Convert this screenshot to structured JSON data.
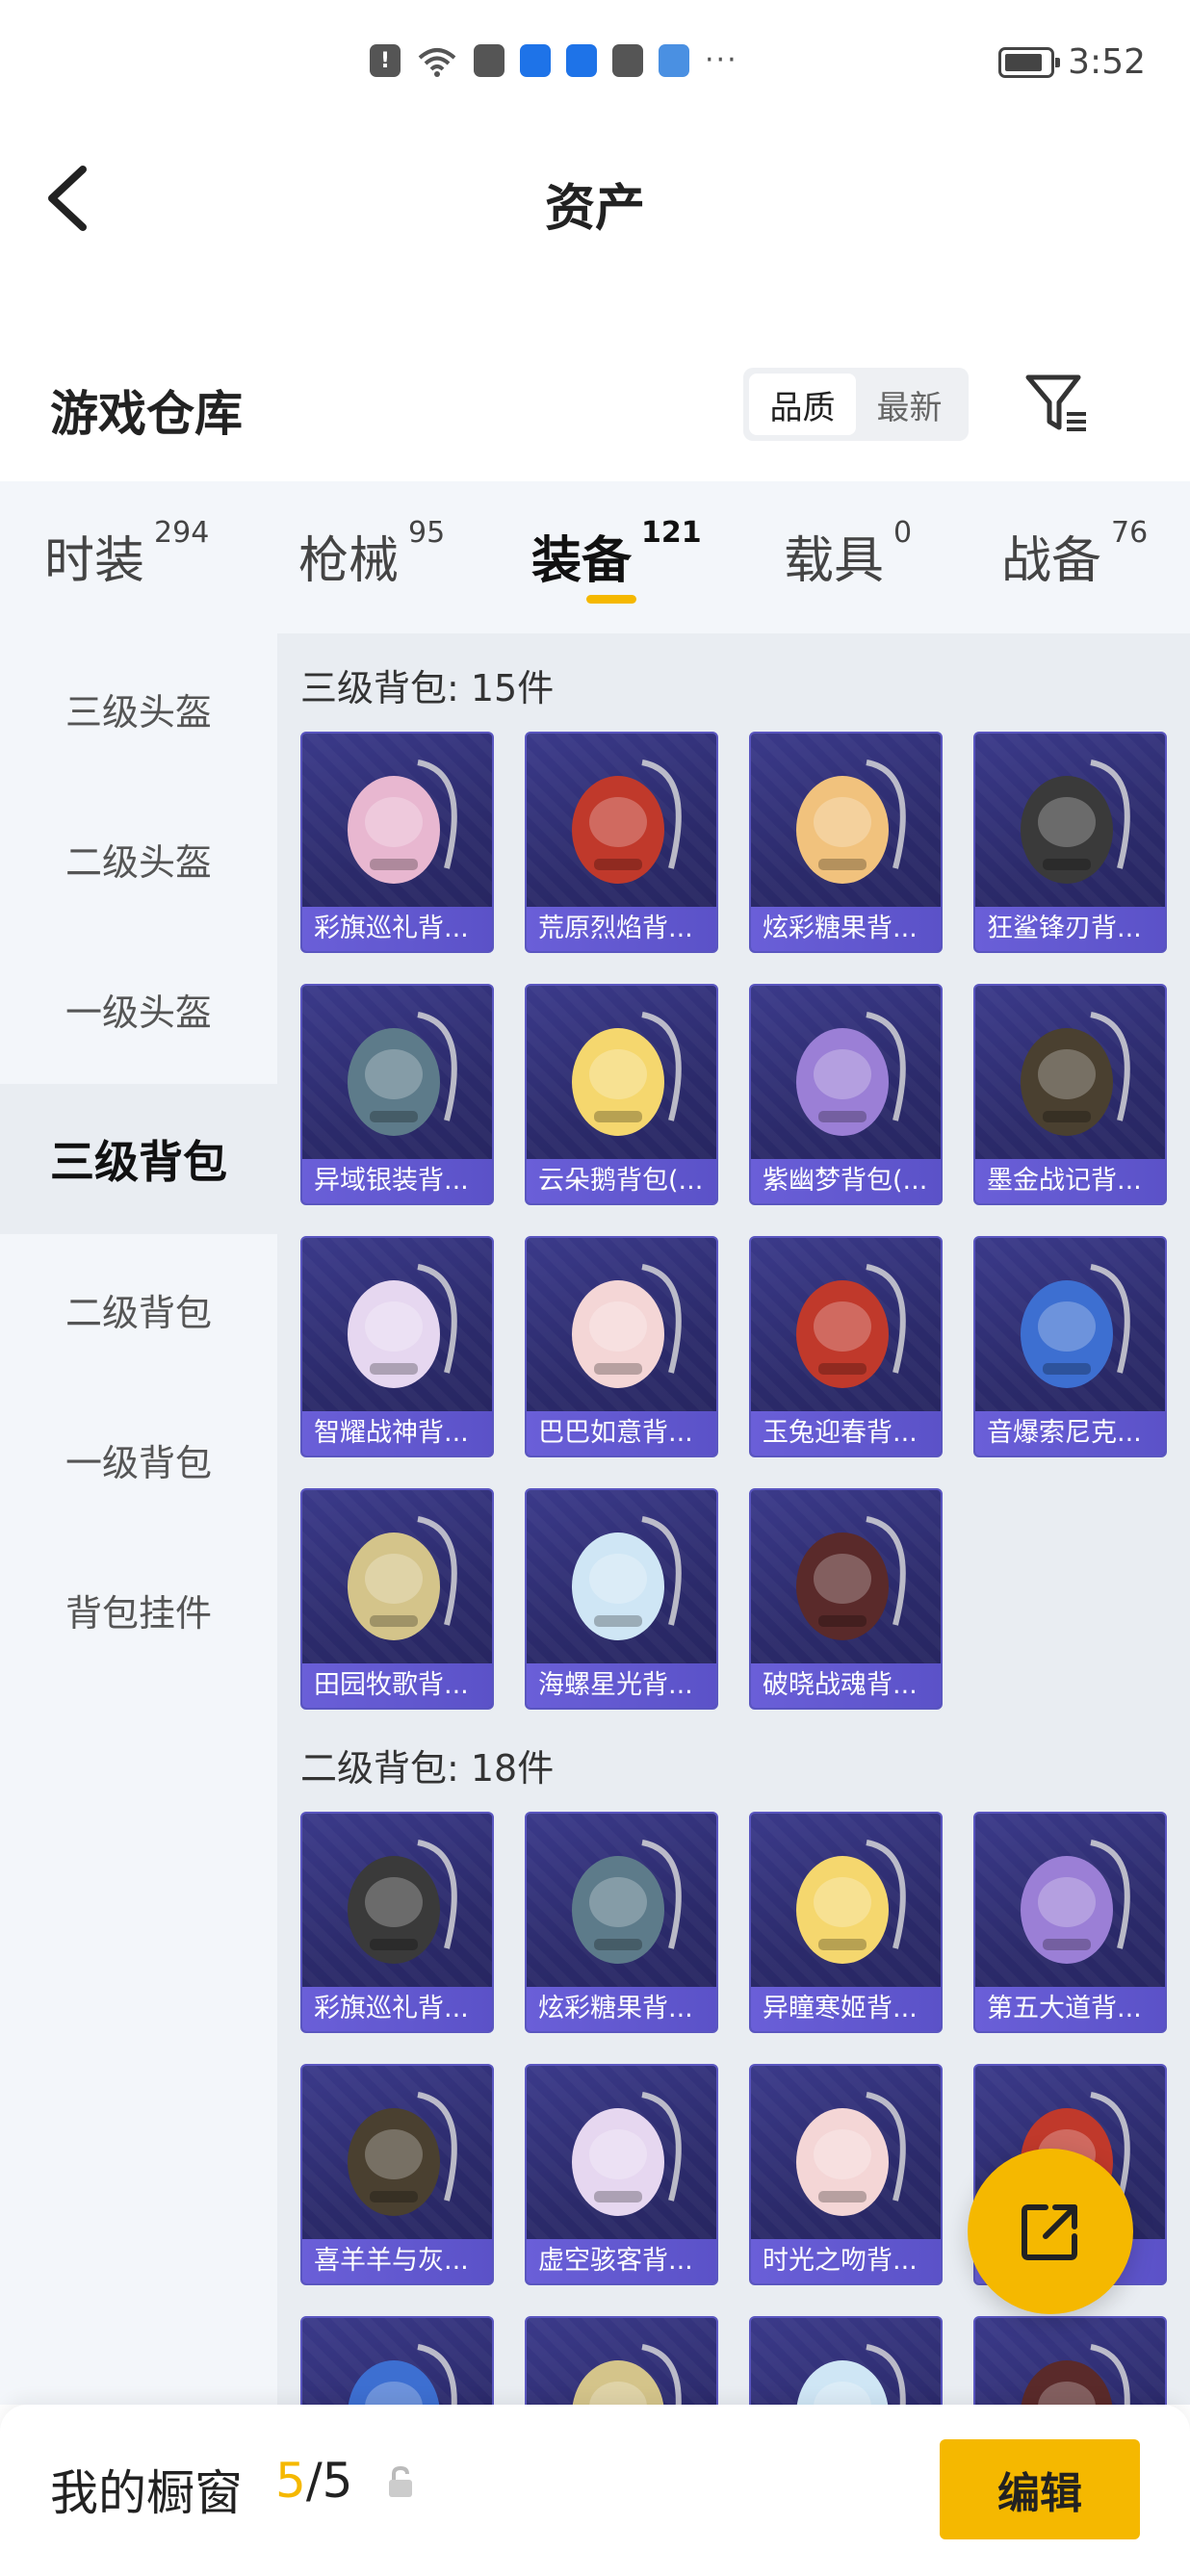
{
  "status_bar": {
    "time": "3:52",
    "signal": "6",
    "more": "···"
  },
  "nav": {
    "title": "资产"
  },
  "warehouse": {
    "title": "游戏仓库",
    "sort_options": [
      "品质",
      "最新"
    ],
    "sort_active": "品质"
  },
  "category_tabs": [
    {
      "label": "时装",
      "count": "294"
    },
    {
      "label": "枪械",
      "count": "95"
    },
    {
      "label": "装备",
      "count": "121",
      "active": true
    },
    {
      "label": "载具",
      "count": "0"
    },
    {
      "label": "战备",
      "count": "76"
    }
  ],
  "side_menu": [
    {
      "label": "三级头盔"
    },
    {
      "label": "二级头盔"
    },
    {
      "label": "一级头盔"
    },
    {
      "label": "三级背包",
      "active": true
    },
    {
      "label": "二级背包"
    },
    {
      "label": "一级背包"
    },
    {
      "label": "背包挂件"
    }
  ],
  "sections": [
    {
      "title": "三级背包: 15件",
      "items": [
        "彩旗巡礼背...",
        "荒原烈焰背...",
        "炫彩糖果背...",
        "狂鲨锋刃背...",
        "异域银装背...",
        "云朵鹅背包(...",
        "紫幽梦背包(...",
        "墨金战记背...",
        "智耀战神背...",
        "巴巴如意背...",
        "玉兔迎春背...",
        "音爆索尼克...",
        "田园牧歌背...",
        "海螺星光背...",
        "破晓战魂背..."
      ]
    },
    {
      "title": "二级背包: 18件",
      "items": [
        "彩旗巡礼背...",
        "炫彩糖果背...",
        "异瞳寒姬背...",
        "第五大道背...",
        "喜羊羊与灰...",
        "虚空骇客背...",
        "时光之吻背...",
        ""
      ]
    }
  ],
  "bottom_bar": {
    "title": "我的橱窗",
    "current": "5",
    "separator": "/",
    "total": "5",
    "edit_label": "编辑"
  },
  "colors": {
    "accent": "#f5b800",
    "card_bg": "#2b2a6a",
    "card_label": "#5b52c8"
  },
  "icons": {
    "back": "chevron-left-icon",
    "filter": "filter-icon",
    "fab": "share-external-icon",
    "lock": "lock-icon"
  }
}
